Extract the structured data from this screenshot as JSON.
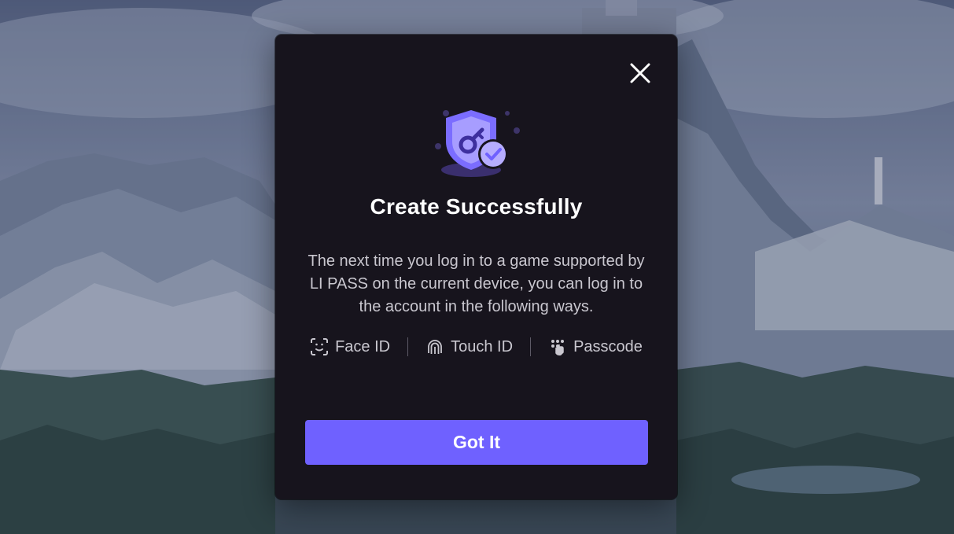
{
  "dialog": {
    "title": "Create Successfully",
    "description": "The next time you log in to a game supported by LI PASS on the current device,  you can log in to the account in the following ways.",
    "methods": [
      {
        "label": "Face ID",
        "icon": "face-id-icon"
      },
      {
        "label": "Touch ID",
        "icon": "fingerprint-icon"
      },
      {
        "label": "Passcode",
        "icon": "passcode-icon"
      }
    ],
    "confirm_label": "Got It",
    "close_icon": "close-icon",
    "illustration_icon": "shield-key-check-icon"
  },
  "colors": {
    "dialog_bg": "#17141d",
    "accent": "#6f61ff",
    "title": "#ffffff",
    "body_text": "#c9c7cf"
  }
}
